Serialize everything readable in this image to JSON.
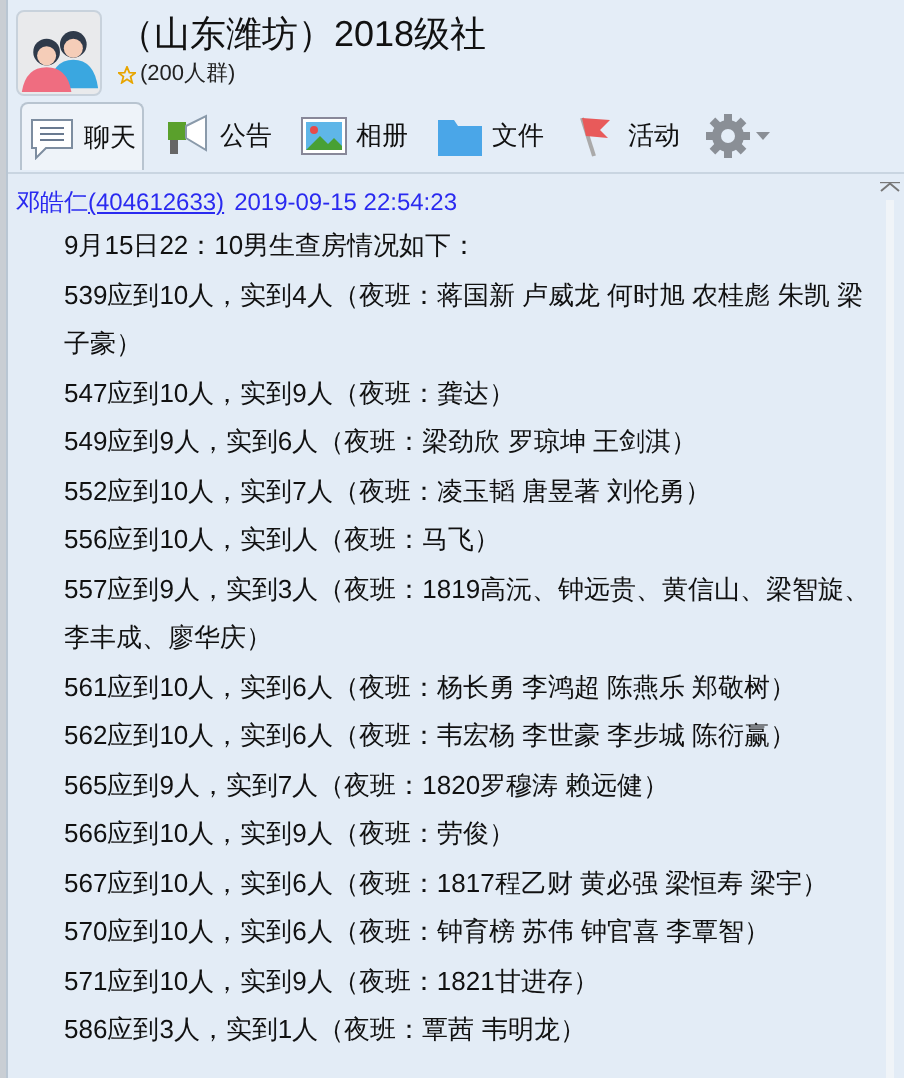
{
  "group": {
    "title": "（山东潍坊）2018级社",
    "member_count": "(200人群)"
  },
  "tabs": [
    {
      "kind": "chat",
      "label": "聊天",
      "selected": true
    },
    {
      "kind": "notice",
      "label": "公告",
      "selected": false
    },
    {
      "kind": "album",
      "label": "相册",
      "selected": false
    },
    {
      "kind": "file",
      "label": "文件",
      "selected": false
    },
    {
      "kind": "activity",
      "label": "活动",
      "selected": false
    }
  ],
  "message": {
    "sender": "邓皓仁",
    "sender_id": "(404612633)",
    "time": "2019-09-15 22:54:23",
    "lines": [
      "9月15日22：10男生查房情况如下：",
      "539应到10人，实到4人（夜班：蒋国新 卢威龙 何时旭 农桂彪 朱凯 梁子豪）",
      "547应到10人，实到9人（夜班：龚达）",
      "549应到9人，实到6人（夜班：梁劲欣 罗琼坤 王剑淇）",
      "552应到10人，实到7人（夜班：凌玉韬 唐昱著 刘伦勇）",
      "556应到10人，实到人（夜班：马飞）",
      "557应到9人，实到3人（夜班：1819高沅、钟远贵、黄信山、梁智旋、李丰成、廖华庆）",
      "561应到10人，实到6人（夜班：杨长勇 李鸿超 陈燕乐 郑敬树）",
      "562应到10人，实到6人（夜班：韦宏杨 李世豪 李步城 陈衍赢）",
      "565应到9人，实到7人（夜班：1820罗穆涛 赖远健）",
      "566应到10人，实到9人（夜班：劳俊）",
      "567应到10人，实到6人（夜班：1817程乙财 黄必强 梁恒寿 梁宇）",
      "570应到10人，实到6人（夜班：钟育榜 苏伟 钟官喜 李覃智）",
      "571应到10人，实到9人（夜班：1821甘进存）",
      "586应到3人，实到1人（夜班：覃茜 韦明龙）"
    ]
  }
}
